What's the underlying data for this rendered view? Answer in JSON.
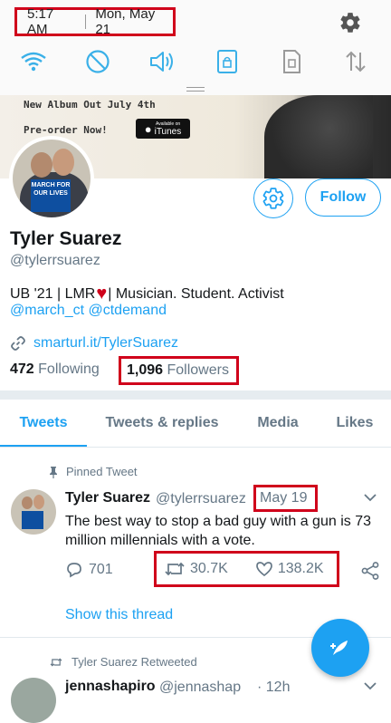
{
  "status_bar": {
    "time": "5:17 AM",
    "date": "Mon, May 21"
  },
  "quick_settings": {
    "icons": [
      "wifi-icon",
      "do-not-disturb-icon",
      "volume-icon",
      "lock-rotation-icon",
      "sim-icon",
      "data-transfer-icon"
    ],
    "accent_color": "#1da1f2"
  },
  "banner": {
    "line1": "New Album Out July 4th",
    "line2": "Pre-order Now!",
    "badge_small": "Available on",
    "badge": "iTunes"
  },
  "profile": {
    "name": "Tyler Suarez",
    "handle": "@tylerrsuarez",
    "bio_part1": "UB '21 | LMR",
    "bio_part2": "| Musician. Student. Activist",
    "mentions": "@march_ct @ctdemand",
    "link": "smarturl.it/TylerSuarez",
    "following_count": "472",
    "following_label": "Following",
    "followers_count": "1,096",
    "followers_label": "Followers",
    "follow_button": "Follow",
    "avatar_sign": "MARCH FOR OUR LIVES"
  },
  "tabs": [
    {
      "label": "Tweets",
      "active": true
    },
    {
      "label": "Tweets & replies",
      "active": false
    },
    {
      "label": "Media",
      "active": false
    },
    {
      "label": "Likes",
      "active": false
    }
  ],
  "pinned_tweet": {
    "pinned_label": "Pinned Tweet",
    "author": "Tyler Suarez",
    "handle": "@tylerrsuarez",
    "date": "May 19",
    "text": "The best way to stop a bad guy with a gun is 73 million millennials with a vote.",
    "replies": "701",
    "retweets": "30.7K",
    "likes": "138.2K",
    "show_thread": "Show this thread"
  },
  "retweet": {
    "label": "Tyler Suarez Retweeted",
    "author": "jennashapiro",
    "handle": "@jennashap",
    "time": "· 12h"
  },
  "highlight_color": "#d0021b"
}
